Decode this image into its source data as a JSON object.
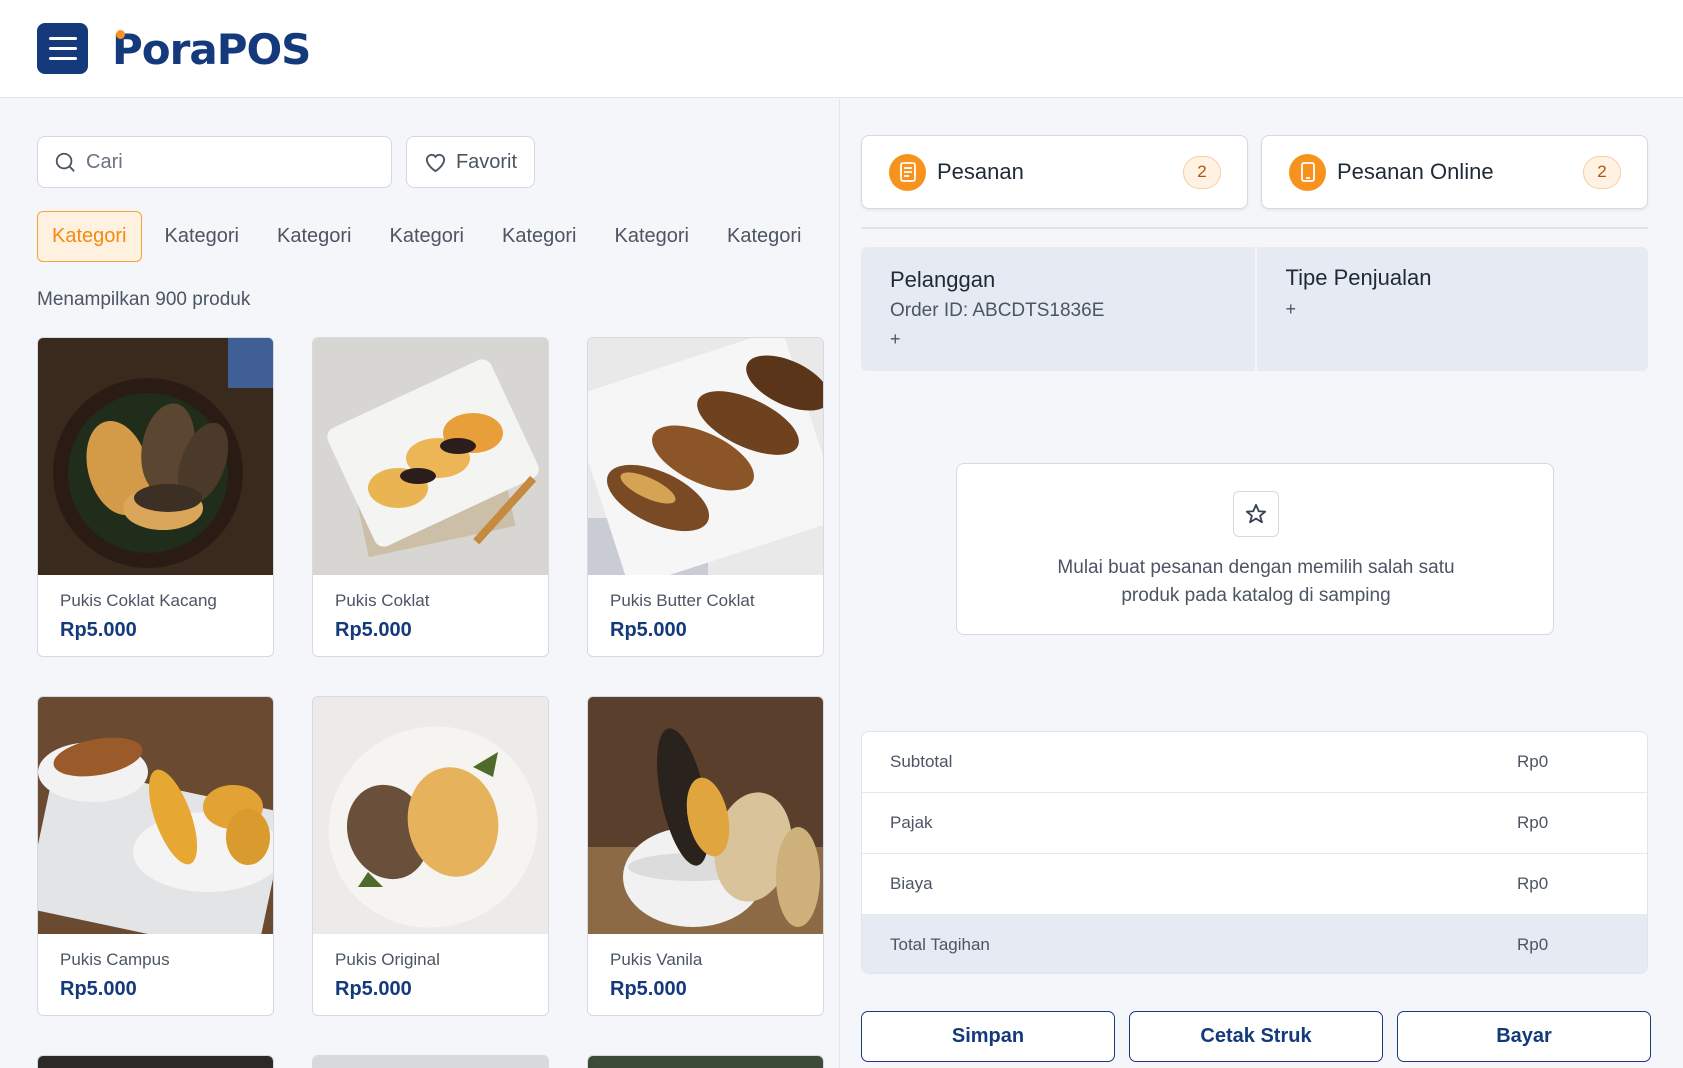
{
  "header": {
    "logo_text": "PoraPOS"
  },
  "search": {
    "placeholder": "Cari",
    "value": ""
  },
  "favorite_label": "Favorit",
  "categories": [
    "Kategori",
    "Kategori",
    "Kategori",
    "Kategori",
    "Kategori",
    "Kategori",
    "Kategori"
  ],
  "active_category_index": 0,
  "product_count_text": "Menampilkan 900 produk",
  "products": [
    {
      "name": "Pukis Coklat Kacang",
      "price": "Rp5.000"
    },
    {
      "name": "Pukis Coklat",
      "price": "Rp5.000"
    },
    {
      "name": "Pukis Butter Coklat",
      "price": "Rp5.000"
    },
    {
      "name": "Pukis Campus",
      "price": "Rp5.000"
    },
    {
      "name": "Pukis Original",
      "price": "Rp5.000"
    },
    {
      "name": "Pukis Vanila",
      "price": "Rp5.000"
    }
  ],
  "order_tabs": [
    {
      "label": "Pesanan",
      "count": "2"
    },
    {
      "label": "Pesanan Online",
      "count": "2"
    }
  ],
  "customer": {
    "title": "Pelanggan",
    "order_id": "Order ID: ABCDTS1836E",
    "add": "+"
  },
  "sale_type": {
    "title": "Tipe Penjualan",
    "add": "+"
  },
  "empty_state": {
    "line1": "Mulai buat pesanan dengan memilih salah satu",
    "line2": "produk pada katalog di samping"
  },
  "summary": [
    {
      "label": "Subtotal",
      "value": "Rp0"
    },
    {
      "label": "Pajak",
      "value": "Rp0"
    },
    {
      "label": "Biaya",
      "value": "Rp0"
    },
    {
      "label": "Total Tagihan",
      "value": "Rp0"
    }
  ],
  "actions": {
    "save": "Simpan",
    "print": "Cetak Struk",
    "pay": "Bayar"
  },
  "colors": {
    "brand_navy": "#143a7b",
    "accent_orange": "#f7921e"
  }
}
